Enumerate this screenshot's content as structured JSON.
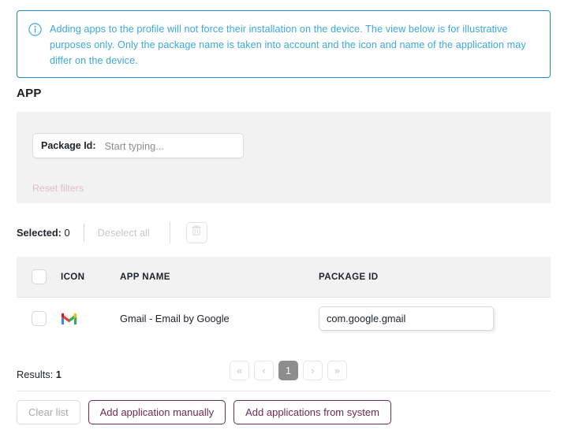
{
  "banner": {
    "icon": "info-circle-icon",
    "text": "Adding apps to the profile will not force their installation on the device. The view below is for illustrative purposes only. Only the package name is taken into account and the icon and name of the application may differ on the device.",
    "border_color": "#1b8cc6",
    "text_color": "#3ba8de"
  },
  "section": {
    "title": "APP"
  },
  "filters": {
    "package_id_label": "Package Id:",
    "package_id_value": "",
    "package_id_placeholder": "Start typing...",
    "reset_label": "Reset filters",
    "reset_color": "#d7c1cf"
  },
  "selection": {
    "selected_label": "Selected:",
    "selected_count": "0",
    "deselect_all_label": "Deselect all",
    "delete_icon": "trash-icon"
  },
  "table": {
    "columns": [
      "",
      "ICON",
      "APP NAME",
      "PACKAGE ID"
    ],
    "rows": [
      {
        "checked": false,
        "icon": "gmail-icon",
        "app_name": "Gmail - Email by Google",
        "package_id": "com.google.gmail"
      }
    ]
  },
  "pagination": {
    "results_label": "Results:",
    "results_count": "1",
    "first_label": "«",
    "prev_label": "‹",
    "current_page": "1",
    "next_label": "›",
    "last_label": "»",
    "active_bg": "#8d8d8d"
  },
  "footer": {
    "clear_list_label": "Clear list",
    "add_manually_label": "Add application manually",
    "add_from_system_label": "Add applications from system",
    "accent_color": "#6e2a4f"
  }
}
